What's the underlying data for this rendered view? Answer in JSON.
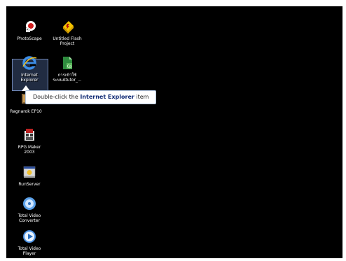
{
  "desktop": {
    "background": "#000000",
    "icons": [
      {
        "id": "photoscape",
        "label": "PhotoScape",
        "icon": "photoscape-icon"
      },
      {
        "id": "flash",
        "label": "Untitled Flash\nProject",
        "icon": "flash-project-icon"
      },
      {
        "id": "ie",
        "label": "Internet\nExplorer",
        "icon": "internet-explorer-icon",
        "selected": true
      },
      {
        "id": "captivate",
        "label": "การเข้าใช้\nระบบAtutor_...",
        "icon": "captivate-icon"
      },
      {
        "id": "ragnarok",
        "label": "Ragnarok EP10",
        "icon": "ragnarok-icon"
      },
      {
        "id": "rpgmaker",
        "label": "RPG Maker\n2003",
        "icon": "rpg-maker-icon"
      },
      {
        "id": "runserver",
        "label": "RunServer",
        "icon": "runserver-icon"
      },
      {
        "id": "tvc",
        "label": "Total Video\nConverter",
        "icon": "total-video-converter-icon"
      },
      {
        "id": "tvp",
        "label": "Total Video\nPlayer",
        "icon": "total-video-player-icon"
      }
    ]
  },
  "tooltip": {
    "prefix": "Double-click the ",
    "highlight": "Internet Explorer",
    "suffix": " item"
  }
}
